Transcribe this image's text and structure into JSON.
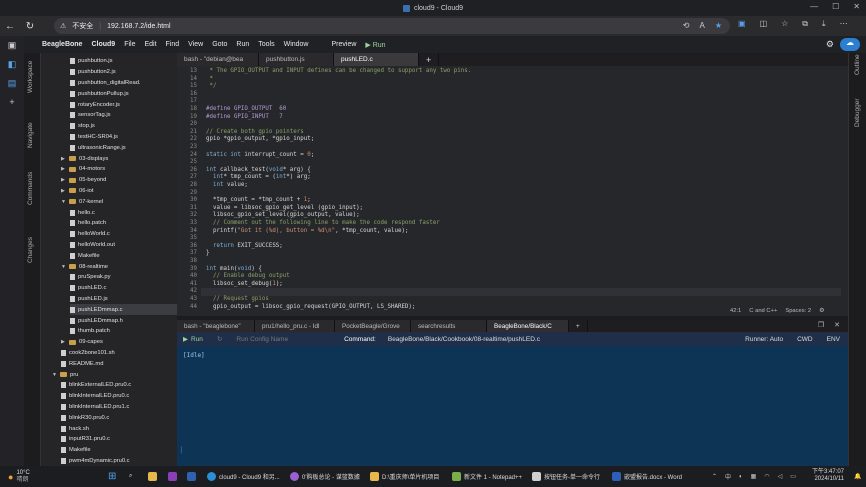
{
  "browser": {
    "window_title": "cloud9 - Cloud9",
    "security_label": "不安全",
    "url": "192.168.7.2/ide.html"
  },
  "menubar": {
    "items": [
      "BeagleBone",
      "Cloud9",
      "File",
      "Edit",
      "Find",
      "View",
      "Goto",
      "Run",
      "Tools",
      "Window"
    ],
    "preview": "Preview",
    "run": "Run"
  },
  "side_panels": {
    "left": [
      "Workspace",
      "Navigate",
      "Commands",
      "Changes"
    ],
    "right": [
      "Outline",
      "Debugger"
    ]
  },
  "tree": [
    {
      "label": "pushbutton.js",
      "type": "file",
      "indent": 3
    },
    {
      "label": "pushbutton2.js",
      "type": "file",
      "indent": 3
    },
    {
      "label": "pushbutton_digitalRead.",
      "type": "file",
      "indent": 3
    },
    {
      "label": "pushbuttonPullup.js",
      "type": "file",
      "indent": 3
    },
    {
      "label": "rotaryEncoder.js",
      "type": "file",
      "indent": 3
    },
    {
      "label": "sensorTag.js",
      "type": "file",
      "indent": 3
    },
    {
      "label": "stop.js",
      "type": "file",
      "indent": 3
    },
    {
      "label": "testHC-SR04.js",
      "type": "file",
      "indent": 3
    },
    {
      "label": "ultrasonicRange.js",
      "type": "file",
      "indent": 3
    },
    {
      "label": "03-displays",
      "type": "folder",
      "indent": 2,
      "arrow": "▶"
    },
    {
      "label": "04-motors",
      "type": "folder",
      "indent": 2,
      "arrow": "▶"
    },
    {
      "label": "05-beyond",
      "type": "folder",
      "indent": 2,
      "arrow": "▶"
    },
    {
      "label": "06-iot",
      "type": "folder",
      "indent": 2,
      "arrow": "▶"
    },
    {
      "label": "07-kernel",
      "type": "folder",
      "indent": 2,
      "arrow": "▼"
    },
    {
      "label": "hello.c",
      "type": "file",
      "indent": 3
    },
    {
      "label": "hello.patch",
      "type": "file",
      "indent": 3
    },
    {
      "label": "helloWorld.c",
      "type": "file",
      "indent": 3
    },
    {
      "label": "helloWorld.out",
      "type": "file",
      "indent": 3
    },
    {
      "label": "Makefile",
      "type": "file",
      "indent": 3
    },
    {
      "label": "08-realtime",
      "type": "folder",
      "indent": 2,
      "arrow": "▼"
    },
    {
      "label": "pruSpeak.py",
      "type": "file",
      "indent": 3
    },
    {
      "label": "pushLED.c",
      "type": "file",
      "indent": 3
    },
    {
      "label": "pushLED.js",
      "type": "file",
      "indent": 3
    },
    {
      "label": "pushLEDmmap.c",
      "type": "file",
      "indent": 3,
      "selected": true
    },
    {
      "label": "pushLEDmmap.h",
      "type": "file",
      "indent": 3
    },
    {
      "label": "thumb.patch",
      "type": "file",
      "indent": 3
    },
    {
      "label": "09-capes",
      "type": "folder",
      "indent": 2,
      "arrow": "▶"
    },
    {
      "label": "cook2bone101.sh",
      "type": "file",
      "indent": 2
    },
    {
      "label": "README.md",
      "type": "file",
      "indent": 2
    },
    {
      "label": "pru",
      "type": "folder",
      "indent": 1,
      "arrow": "▼"
    },
    {
      "label": "blinkExternalLED.pru0.c",
      "type": "file",
      "indent": 2
    },
    {
      "label": "blinkInternalLED.pru0.c",
      "type": "file",
      "indent": 2
    },
    {
      "label": "blinkInternalLED.pru1.c",
      "type": "file",
      "indent": 2
    },
    {
      "label": "blinkR30.pru0.c",
      "type": "file",
      "indent": 2
    },
    {
      "label": "hack.sh",
      "type": "file",
      "indent": 2
    },
    {
      "label": "inputR31.pru0.c",
      "type": "file",
      "indent": 2
    },
    {
      "label": "Makefile",
      "type": "file",
      "indent": 2
    },
    {
      "label": "pwm4mDynamic.pru0.c",
      "type": "file",
      "indent": 2
    }
  ],
  "editor_tabs": [
    "bash - \"debian@bea",
    "pushbutton.js",
    "pushLED.c"
  ],
  "editor_active_tab": 2,
  "code": [
    {
      "n": "13",
      "t": [
        [
          "cm",
          " * The GPIO_OUTPUT and INPUT defines can be changed to support any two pins."
        ]
      ]
    },
    {
      "n": "14",
      "t": [
        [
          "cm",
          " *"
        ]
      ]
    },
    {
      "n": "15",
      "t": [
        [
          "cm",
          " */"
        ]
      ]
    },
    {
      "n": "16",
      "t": []
    },
    {
      "n": "17",
      "t": []
    },
    {
      "n": "18",
      "t": [
        [
          "df",
          "#define GPIO_OUTPUT  60"
        ]
      ]
    },
    {
      "n": "19",
      "t": [
        [
          "df",
          "#define GPIO_INPUT   7"
        ]
      ]
    },
    {
      "n": "20",
      "t": []
    },
    {
      "n": "21",
      "t": [
        [
          "cm",
          "// Create both gpio pointers"
        ]
      ]
    },
    {
      "n": "22",
      "t": [
        [
          "tx",
          "gpio *gpio_output, *gpio_input;"
        ]
      ]
    },
    {
      "n": "23",
      "t": []
    },
    {
      "n": "24",
      "t": [
        [
          "kw",
          "static int "
        ],
        [
          "tx",
          "interrupt_count = "
        ],
        [
          "nm",
          "0"
        ],
        [
          "tx",
          ";"
        ]
      ]
    },
    {
      "n": "25",
      "t": []
    },
    {
      "n": "26",
      "t": [
        [
          "kw",
          "int "
        ],
        [
          "tx",
          "callback_test("
        ],
        [
          "kw",
          "void"
        ],
        [
          "tx",
          "* arg) {"
        ]
      ]
    },
    {
      "n": "27",
      "t": [
        [
          "kw",
          "  int"
        ],
        [
          "tx",
          "* tmp_count = ("
        ],
        [
          "kw",
          "int"
        ],
        [
          "tx",
          "*) arg;"
        ]
      ]
    },
    {
      "n": "28",
      "t": [
        [
          "kw",
          "  int "
        ],
        [
          "tx",
          "value;"
        ]
      ]
    },
    {
      "n": "29",
      "t": []
    },
    {
      "n": "30",
      "t": [
        [
          "tx",
          "  *tmp_count = *tmp_count + "
        ],
        [
          "nm",
          "1"
        ],
        [
          "tx",
          ";"
        ]
      ]
    },
    {
      "n": "31",
      "t": [
        [
          "tx",
          "  value = libsoc_gpio_get_level (gpio_input);"
        ]
      ]
    },
    {
      "n": "32",
      "t": [
        [
          "tx",
          "  libsoc_gpio_set_level(gpio_output, value);"
        ]
      ]
    },
    {
      "n": "33",
      "t": [
        [
          "cm",
          "  // Comment out the following line to make the code respond faster"
        ]
      ]
    },
    {
      "n": "34",
      "t": [
        [
          "tx",
          "  printf("
        ],
        [
          "st",
          "\"Got it (%d), button = %d\\n\""
        ],
        [
          "tx",
          ", *tmp_count, value);"
        ]
      ]
    },
    {
      "n": "35",
      "t": []
    },
    {
      "n": "36",
      "t": [
        [
          "kw",
          "  return "
        ],
        [
          "tx",
          "EXIT_SUCCESS;"
        ]
      ]
    },
    {
      "n": "37",
      "t": [
        [
          "tx",
          "}"
        ]
      ]
    },
    {
      "n": "38",
      "t": []
    },
    {
      "n": "39",
      "t": [
        [
          "kw",
          "int "
        ],
        [
          "tx",
          "main("
        ],
        [
          "kw",
          "void"
        ],
        [
          "tx",
          ") {"
        ]
      ]
    },
    {
      "n": "40",
      "t": [
        [
          "cm",
          "  // Enable debug output"
        ]
      ]
    },
    {
      "n": "41",
      "t": [
        [
          "tx",
          "  libsoc_set_debug("
        ],
        [
          "nm",
          "1"
        ],
        [
          "tx",
          ");"
        ]
      ]
    },
    {
      "n": "42",
      "t": [],
      "cur": true
    },
    {
      "n": "43",
      "t": [
        [
          "cm",
          "  // Request gpios"
        ]
      ]
    },
    {
      "n": "44",
      "t": [
        [
          "tx",
          "  gpio_output = libsoc_gpio_request(GPIO_OUTPUT, LS_SHARED);"
        ]
      ]
    }
  ],
  "editor_status": {
    "position": "42:1",
    "language": "C and C++",
    "spaces": "Spaces: 2"
  },
  "terminal_tabs": [
    "bash - \"beaglebone\"",
    "pru1/hello_pru.c - Idl",
    "PocketBeagle/Grove",
    "searchresults",
    "BeagleBone/Black/C"
  ],
  "terminal_active_tab": 4,
  "runbar": {
    "run": "Run",
    "config_placeholder": "Run Config Name",
    "command_label": "Command:",
    "command": "BeagleBone/Black/Cookbook/08-realtime/pushLED.c",
    "runner": "Runner: Auto",
    "cwd": "CWD",
    "env": "ENV"
  },
  "terminal_output": "[Idle]",
  "taskbar": {
    "weather_temp": "10°C",
    "weather_desc": "晴朗",
    "items": [
      "cloud9 - Cloud9 和另...",
      "0'购板总论 - 谋篮数據",
      "D:\\重庆师\\单片机项目",
      "新文件 1 - Notepad++",
      "按钮任务-单一命令行",
      "嵌盟报告.docx - Word"
    ],
    "ime": "中",
    "time": "下午3:47:07",
    "date": "2024/10/11"
  }
}
